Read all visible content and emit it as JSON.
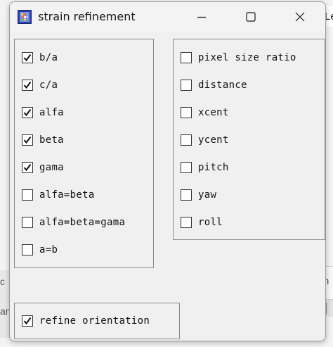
{
  "window": {
    "title": "strain refinement",
    "icon": "grid-app-icon"
  },
  "background": {
    "top_fragment_text": "Le",
    "mid_fragment_text": "h",
    "left_fragment_text_1": "c",
    "left_fragment_text_2": "an"
  },
  "left_group": {
    "items": [
      {
        "label": "b/a",
        "checked": true
      },
      {
        "label": "c/a",
        "checked": true
      },
      {
        "label": "alfa",
        "checked": true
      },
      {
        "label": "beta",
        "checked": true
      },
      {
        "label": "gama",
        "checked": true
      },
      {
        "label": "alfa=beta",
        "checked": false
      },
      {
        "label": "alfa=beta=gama",
        "checked": false
      },
      {
        "label": "a=b",
        "checked": false
      }
    ]
  },
  "right_group": {
    "items": [
      {
        "label": "pixel size ratio",
        "checked": false
      },
      {
        "label": "distance",
        "checked": false
      },
      {
        "label": "xcent",
        "checked": false
      },
      {
        "label": "ycent",
        "checked": false
      },
      {
        "label": "pitch",
        "checked": false
      },
      {
        "label": "yaw",
        "checked": false
      },
      {
        "label": "roll",
        "checked": false
      }
    ]
  },
  "bottom_group": {
    "items": [
      {
        "label": "refine orientation",
        "checked": true
      }
    ]
  }
}
